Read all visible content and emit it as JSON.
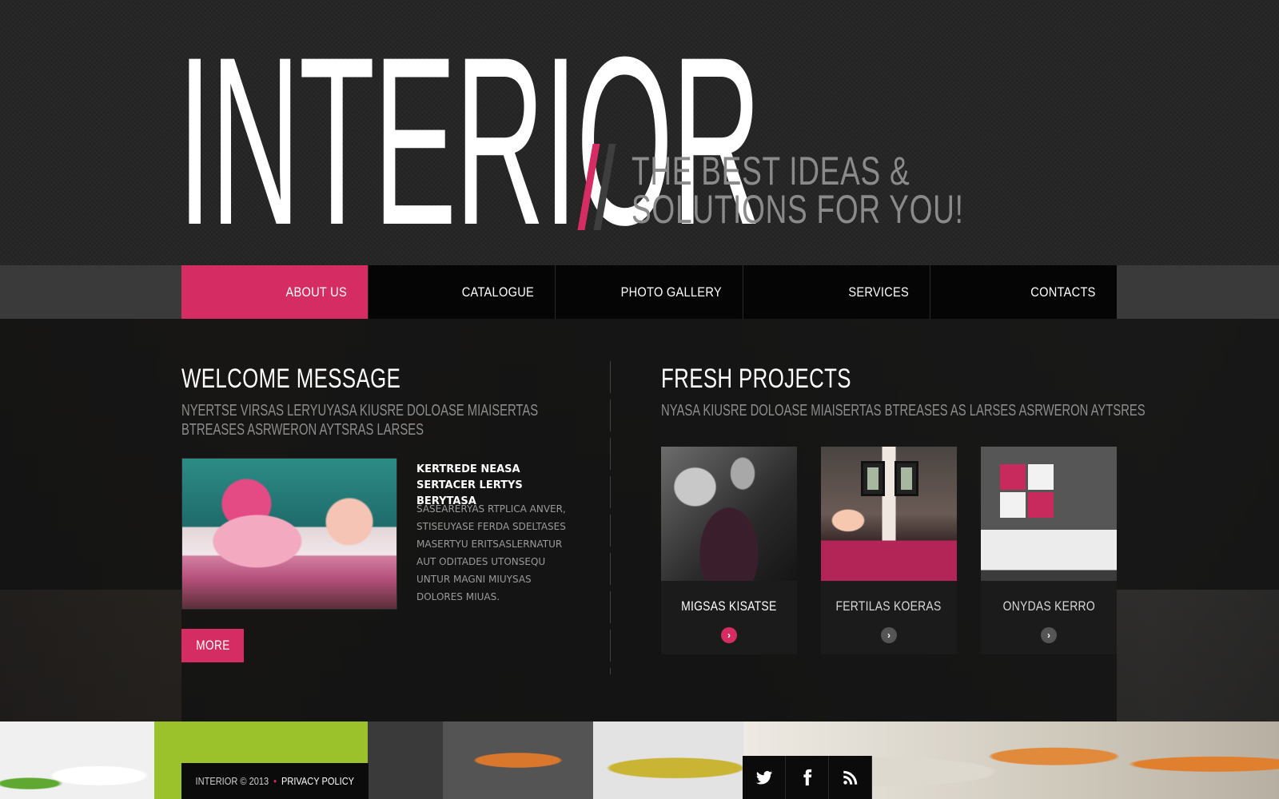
{
  "brand": {
    "logo": "INTERIOR",
    "tagline_line1": "THE BEST IDEAS &",
    "tagline_line2": "SOLUTIONS FOR YOU!",
    "accent_color": "#d52d63"
  },
  "nav": {
    "items": [
      {
        "label": "ABOUT US",
        "active": true
      },
      {
        "label": "CATALOGUE",
        "active": false
      },
      {
        "label": "PHOTO GALLERY",
        "active": false
      },
      {
        "label": "SERVICES",
        "active": false
      },
      {
        "label": "CONTACTS",
        "active": false
      }
    ]
  },
  "welcome": {
    "title": "WELCOME MESSAGE",
    "subtitle": "NYERTSE VIRSAS LERYUYASA KIUSRE DOLOASE MIAISERTAS BTREASES ASRWERON AYTSRAS LARSES",
    "item_heading": "KERTREDE NEASA SERTACER LERTYS BERYTASA",
    "item_text": "SASEARERYAS RTPLICA ANVER, STISEUYASE FERDA SDELTASES MASERTYU ERITSASLERNATUR AUT ODITADES UTONSEQU UNTUR MAGNI MIUYSAS DOLORES MIUAS.",
    "more_label": "MORE"
  },
  "projects": {
    "title": "FRESH PROJECTS",
    "subtitle": "NYASA KIUSRE DOLOASE MIAISERTAS BTREASES AS LARSES ASRWERON AYTSRES",
    "items": [
      {
        "name": "MIGSAS KISATSE",
        "arrow": "chevron-right-icon"
      },
      {
        "name": "FERTILAS KOERAS",
        "arrow": "chevron-right-icon"
      },
      {
        "name": "ONYDAS KERRO",
        "arrow": "chevron-right-icon"
      }
    ]
  },
  "footer": {
    "copyright": "INTERIOR © 2013",
    "separator": "•",
    "privacy_label": "PRIVACY POLICY",
    "social": [
      "twitter-icon",
      "facebook-icon",
      "rss-icon"
    ]
  }
}
